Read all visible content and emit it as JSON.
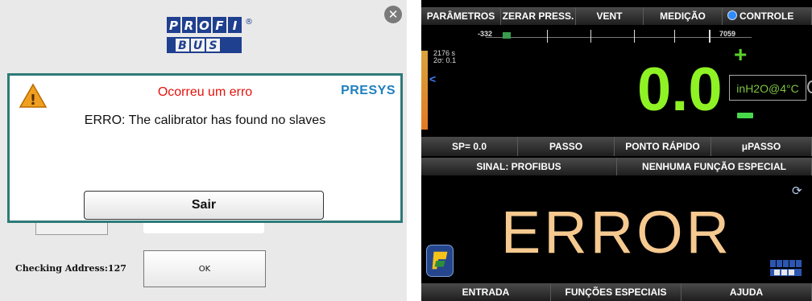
{
  "left_panel": {
    "logo_text": "PROFI BUS",
    "dialog": {
      "title": "Ocorreu um erro",
      "brand": "PRESYS",
      "message": "ERRO: The calibrator has found no slaves",
      "exit_button": "Sair"
    },
    "checking_address": "Checking Address:127",
    "ok_button": "OK",
    "colors": {
      "dialog_border": "#2d7a77",
      "title_red": "#e3120b",
      "brand_blue": "#1f7fbf"
    }
  },
  "right_panel": {
    "top_menu": [
      {
        "label": "PARÂMETROS"
      },
      {
        "label": "ZERAR PRESS."
      },
      {
        "label": "VENT"
      },
      {
        "label": "MEDIÇÃO"
      },
      {
        "label": "CONTROLE"
      }
    ],
    "scale": {
      "min_label": "-332",
      "max_label": "7059"
    },
    "stats": {
      "line1": "2176 s",
      "line2": "2σ: 0.1"
    },
    "reading": {
      "value": "0.0",
      "unit": "inH2O@4°C"
    },
    "setpoint_bar": [
      {
        "label": "SP= 0.0"
      },
      {
        "label": "PASSO"
      },
      {
        "label": "PONTO RÁPIDO"
      },
      {
        "label": "μPASSO"
      }
    ],
    "signal_bar": [
      {
        "label": "SINAL: PROFIBUS"
      },
      {
        "label": "NENHUMA FUNÇÃO ESPECIAL"
      }
    ],
    "status": "ERROR",
    "bottom_bar": [
      {
        "label": "ENTRADA"
      },
      {
        "label": "FUNÇÕES ESPECIAIS"
      },
      {
        "label": "AJUDA"
      }
    ],
    "icons": [
      "close-icon",
      "warning-icon",
      "chevron-left-icon",
      "plus-icon",
      "minus-icon",
      "refresh-icon",
      "profibus-icon"
    ],
    "colors": {
      "value_green": "#8ff224",
      "error_peach": "#f5c98f",
      "radio_blue": "#2f8cff"
    }
  }
}
